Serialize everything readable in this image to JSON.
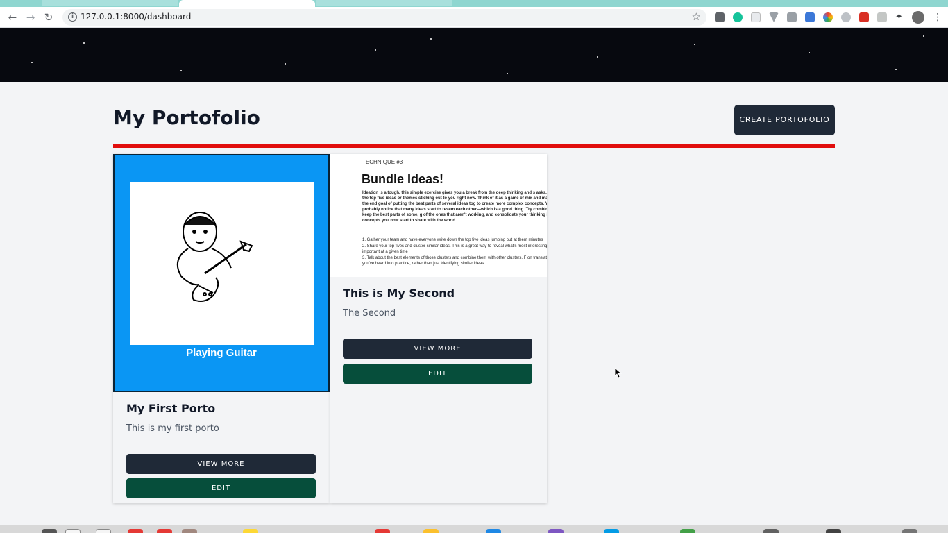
{
  "browser": {
    "url": "127.0.0.1:8000/dashboard",
    "extension_icons": [
      "reader-icon",
      "grammarly-icon",
      "box-icon",
      "vuetify-icon",
      "camera-icon",
      "pen-icon",
      "colorpicker-icon",
      "settings-icon",
      "youtube-icon",
      "page-icon",
      "extensions-icon",
      "profile-avatar"
    ]
  },
  "page": {
    "title": "My Portofolio",
    "create_button": "CREATE PORTOFOLIO"
  },
  "cards": [
    {
      "image_caption": "Playing Guitar",
      "title": "My First Porto",
      "description": "This is my first porto",
      "view_more": "VIEW MORE",
      "edit": "EDIT"
    },
    {
      "image_doc": {
        "kicker": "TECHNIQUE #3",
        "heading": "Bundle Ideas!",
        "paragraph": "Ideation is a tough, this simple exercise gives you a break from the deep thinking and s asks, what are the top five ideas or themes sticking out to you right now. Think of it as a game of mix and match, with the end goal of putting the best parts of several ideas tog to create more complex concepts. You'll probably notice that many ideas start to resem each other—which is a good thing. Try combining them; keep the best parts of some, g of the ones that aren't working, and consolidate your thinking into a few concepts you now start to share with the world.",
        "list": [
          "1. Gather your team and have everyone write down the top five ideas jumping out at them minutes",
          "2. Share your top fives and cluster similar ideas. This is a great way to reveal what's most interesting or important at a given time",
          "3. Talk about the best elements of those clusters and combine them with other clusters. F on translating what you've heard into practice, rather than just identifying similar ideas."
        ]
      },
      "title": "This is My Second",
      "description": "The Second",
      "view_more": "VIEW MORE",
      "edit": "EDIT"
    }
  ],
  "colors": {
    "accent_rule": "#e10d0d",
    "dark_button": "#1f2937",
    "edit_button": "#064e3b",
    "card1_bg": "#0a96f4"
  }
}
